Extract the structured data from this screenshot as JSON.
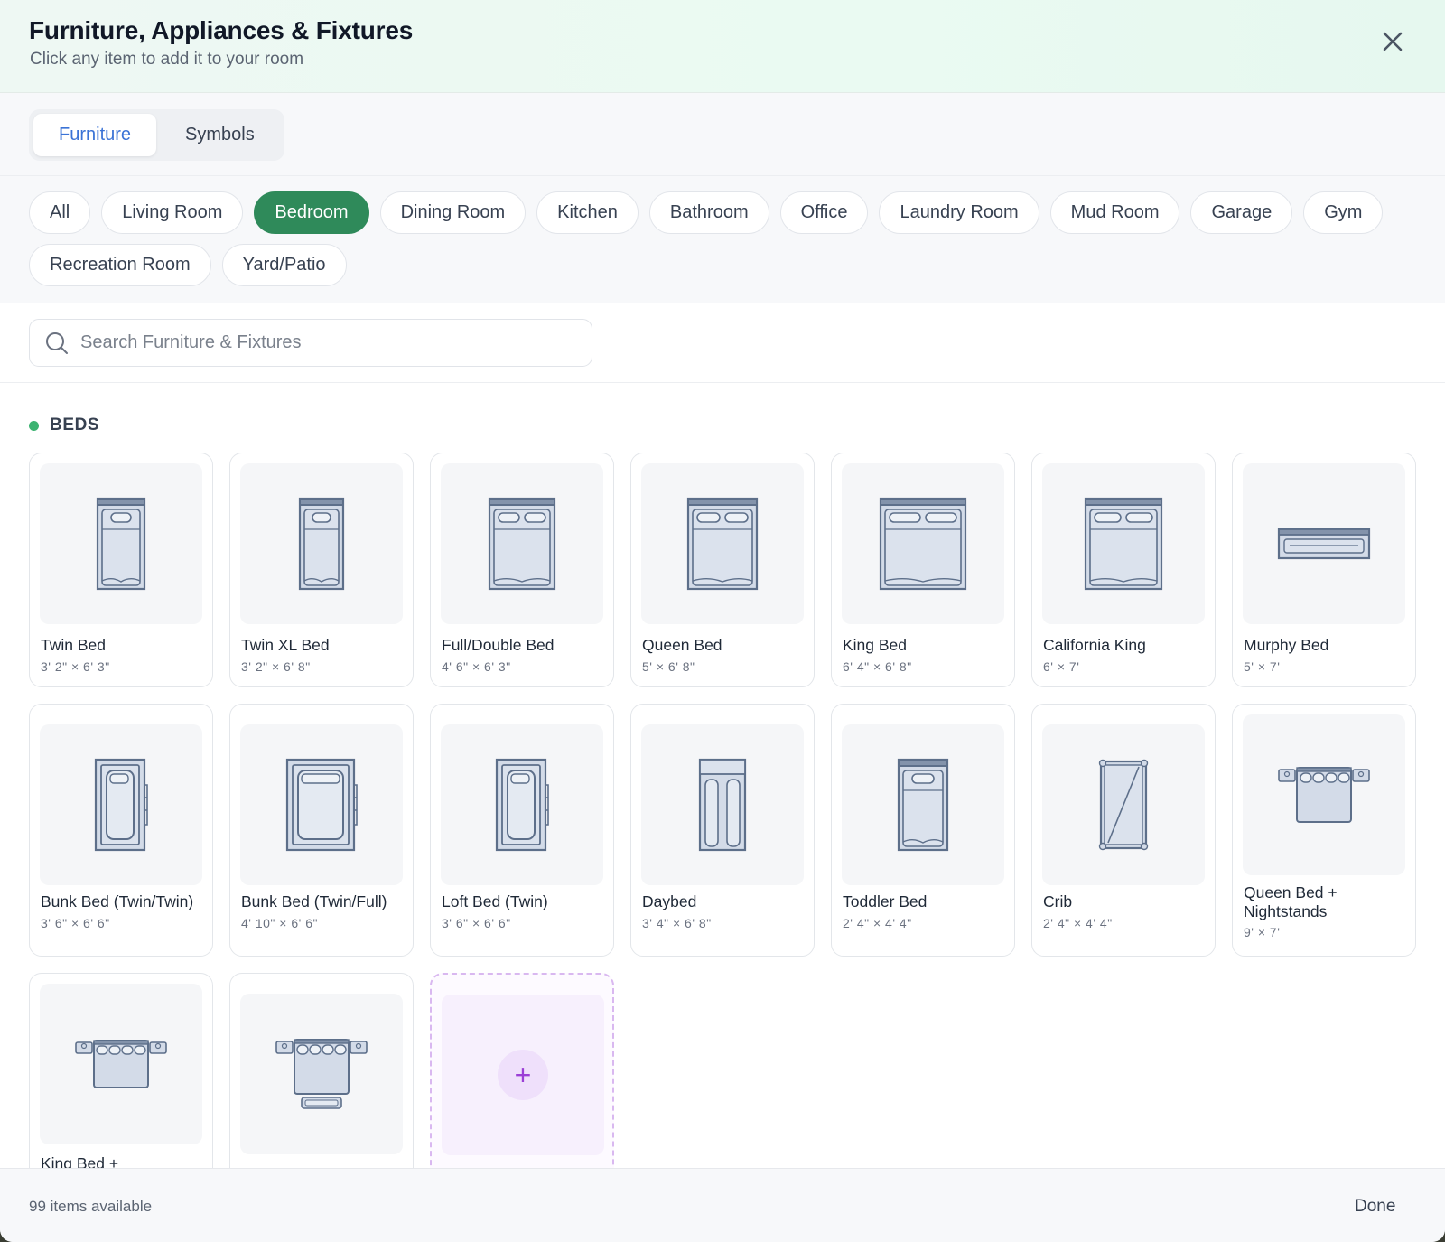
{
  "header": {
    "title": "Furniture, Appliances & Fixtures",
    "subtitle": "Click any item to add it to your room",
    "close_icon": "close-icon"
  },
  "tabs": [
    {
      "label": "Furniture",
      "active": true
    },
    {
      "label": "Symbols",
      "active": false
    }
  ],
  "categories": [
    {
      "label": "All"
    },
    {
      "label": "Living Room"
    },
    {
      "label": "Bedroom",
      "active": true
    },
    {
      "label": "Dining Room"
    },
    {
      "label": "Kitchen"
    },
    {
      "label": "Bathroom"
    },
    {
      "label": "Office"
    },
    {
      "label": "Laundry Room"
    },
    {
      "label": "Mud Room"
    },
    {
      "label": "Garage"
    },
    {
      "label": "Gym"
    },
    {
      "label": "Recreation Room"
    },
    {
      "label": "Yard/Patio"
    }
  ],
  "search": {
    "placeholder": "Search Furniture & Fixtures",
    "value": ""
  },
  "section": {
    "title": "BEDS",
    "accent": "#3cb371"
  },
  "items": [
    {
      "name": "Twin Bed",
      "dims": "3' 2\" × 6' 3\"",
      "icon": "twin-bed-icon"
    },
    {
      "name": "Twin XL Bed",
      "dims": "3' 2\" × 6' 8\"",
      "icon": "twin-xl-bed-icon"
    },
    {
      "name": "Full/Double Bed",
      "dims": "4' 6\" × 6' 3\"",
      "icon": "full-bed-icon"
    },
    {
      "name": "Queen Bed",
      "dims": "5' × 6' 8\"",
      "icon": "queen-bed-icon"
    },
    {
      "name": "King Bed",
      "dims": "6' 4\" × 6' 8\"",
      "icon": "king-bed-icon"
    },
    {
      "name": "California King",
      "dims": "6' × 7'",
      "icon": "california-king-bed-icon"
    },
    {
      "name": "Murphy Bed",
      "dims": "5' × 7'",
      "icon": "murphy-bed-icon"
    },
    {
      "name": "Bunk Bed (Twin/Twin)",
      "dims": "3' 6\" × 6' 6\"",
      "icon": "bunk-bed-twin-icon"
    },
    {
      "name": "Bunk Bed (Twin/Full)",
      "dims": "4' 10\" × 6' 6\"",
      "icon": "bunk-bed-full-icon"
    },
    {
      "name": "Loft Bed (Twin)",
      "dims": "3' 6\" × 6' 6\"",
      "icon": "loft-bed-icon"
    },
    {
      "name": "Daybed",
      "dims": "3' 4\" × 6' 8\"",
      "icon": "daybed-icon"
    },
    {
      "name": "Toddler Bed",
      "dims": "2' 4\" × 4' 4\"",
      "icon": "toddler-bed-icon"
    },
    {
      "name": "Crib",
      "dims": "2' 4\" × 4' 4\"",
      "icon": "crib-icon"
    },
    {
      "name": "Queen Bed + Nightstands",
      "dims": "9' × 7'",
      "icon": "queen-bed-nightstands-icon"
    },
    {
      "name": "King Bed +",
      "dims": "",
      "icon": "king-bed-nightstands-icon"
    },
    {
      "name": "",
      "dims": "",
      "icon": "bed-nightstands-bench-icon"
    }
  ],
  "add_custom": {
    "icon": "plus-icon",
    "symbol": "+"
  },
  "footer": {
    "count_text": "99 items available",
    "done_label": "Done"
  }
}
